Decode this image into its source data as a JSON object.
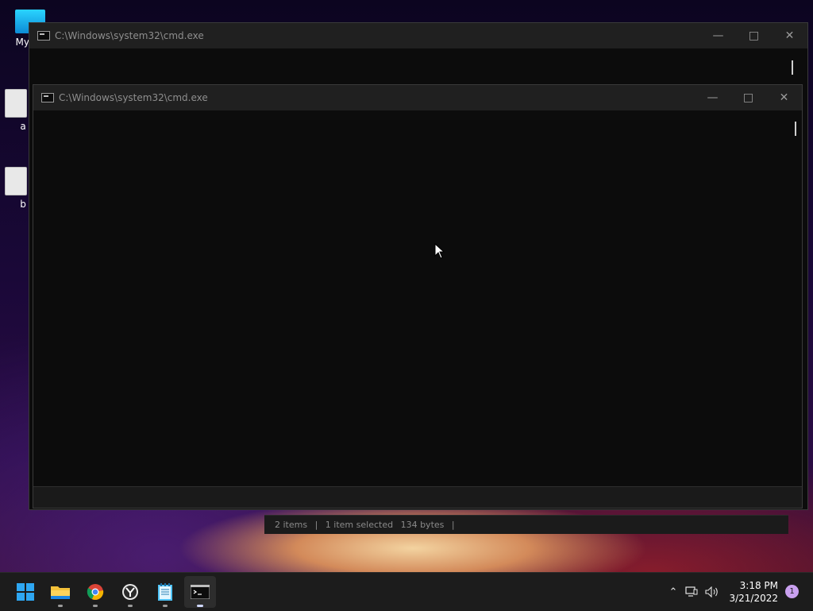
{
  "desktop": {
    "icons": [
      {
        "label": "My Co"
      },
      {
        "label": "a"
      },
      {
        "label": "b"
      }
    ]
  },
  "explorer_status": {
    "items": "2 items",
    "selected": "1 item selected",
    "size": "134 bytes"
  },
  "window_back": {
    "title": "C:\\Windows\\system32\\cmd.exe"
  },
  "window_front": {
    "title": "C:\\Windows\\system32\\cmd.exe"
  },
  "taskbar": {
    "apps": [
      {
        "name": "start-button"
      },
      {
        "name": "file-explorer"
      },
      {
        "name": "chrome"
      },
      {
        "name": "yandex"
      },
      {
        "name": "notepad"
      },
      {
        "name": "command-prompt"
      }
    ],
    "clock_time": "3:18 PM",
    "clock_date": "3/21/2022",
    "notification_count": "1"
  },
  "colors": {
    "accent": "#0078d4",
    "console_bg": "#0c0c0c",
    "titlebar_bg": "#202020"
  }
}
